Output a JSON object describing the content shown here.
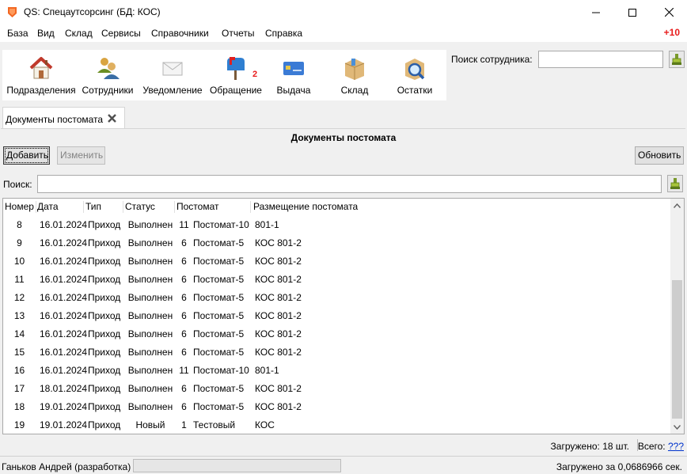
{
  "window": {
    "title": "QS: Спецаутсорсинг (БД: КОС)"
  },
  "menu": {
    "items": [
      "База",
      "Вид",
      "Склад",
      "Сервисы",
      "Справочники",
      "Отчеты",
      "Справка"
    ],
    "notification_count": "+10"
  },
  "toolbar": {
    "items": [
      {
        "label": "Подразделения",
        "icon": "house-icon"
      },
      {
        "label": "Сотрудники",
        "icon": "people-icon"
      },
      {
        "label": "Уведомление",
        "icon": "envelope-icon"
      },
      {
        "label": "Обращение",
        "icon": "mailbox-icon",
        "badge": "2"
      },
      {
        "label": "Выдача",
        "icon": "card-icon"
      },
      {
        "label": "Склад",
        "icon": "box-icon"
      },
      {
        "label": "Остатки",
        "icon": "box-search-icon"
      }
    ],
    "employee_search_label": "Поиск сотрудника:"
  },
  "tabs": [
    {
      "label": "Документы постомата"
    }
  ],
  "panel": {
    "title": "Документы постомата",
    "add_label": "Добавить",
    "edit_label": "Изменить",
    "refresh_label": "Обновить",
    "search_label": "Поиск:"
  },
  "table": {
    "columns": [
      "Номер",
      "Дата",
      "Тип",
      "Статус",
      "Постомат",
      "Размещение постомата"
    ],
    "rows": [
      [
        "8",
        "16.01.2024",
        "Приход",
        "Выполнен",
        "11",
        "Постомат-10",
        "801-1"
      ],
      [
        "9",
        "16.01.2024",
        "Приход",
        "Выполнен",
        "6",
        "Постомат-5",
        "КОС 801-2"
      ],
      [
        "10",
        "16.01.2024",
        "Приход",
        "Выполнен",
        "6",
        "Постомат-5",
        "КОС 801-2"
      ],
      [
        "11",
        "16.01.2024",
        "Приход",
        "Выполнен",
        "6",
        "Постомат-5",
        "КОС 801-2"
      ],
      [
        "12",
        "16.01.2024",
        "Приход",
        "Выполнен",
        "6",
        "Постомат-5",
        "КОС 801-2"
      ],
      [
        "13",
        "16.01.2024",
        "Приход",
        "Выполнен",
        "6",
        "Постомат-5",
        "КОС 801-2"
      ],
      [
        "14",
        "16.01.2024",
        "Приход",
        "Выполнен",
        "6",
        "Постомат-5",
        "КОС 801-2"
      ],
      [
        "15",
        "16.01.2024",
        "Приход",
        "Выполнен",
        "6",
        "Постомат-5",
        "КОС 801-2"
      ],
      [
        "16",
        "16.01.2024",
        "Приход",
        "Выполнен",
        "11",
        "Постомат-10",
        "801-1"
      ],
      [
        "17",
        "18.01.2024",
        "Приход",
        "Выполнен",
        "6",
        "Постомат-5",
        "КОС 801-2"
      ],
      [
        "18",
        "19.01.2024",
        "Приход",
        "Выполнен",
        "6",
        "Постомат-5",
        "КОС 801-2"
      ],
      [
        "19",
        "19.01.2024",
        "Приход",
        "Новый",
        "1",
        "Тестовый",
        "КОС"
      ]
    ]
  },
  "info": {
    "loaded": "Загружено: 18 шт.",
    "total_label": "Всего:",
    "total_value": "???"
  },
  "status": {
    "user": "Ганьков Андрей (разработка)",
    "load_time": "Загружено за 0,0686966 сек."
  },
  "colors": {
    "accent_red": "#e81c1c",
    "link": "#0033cc"
  }
}
